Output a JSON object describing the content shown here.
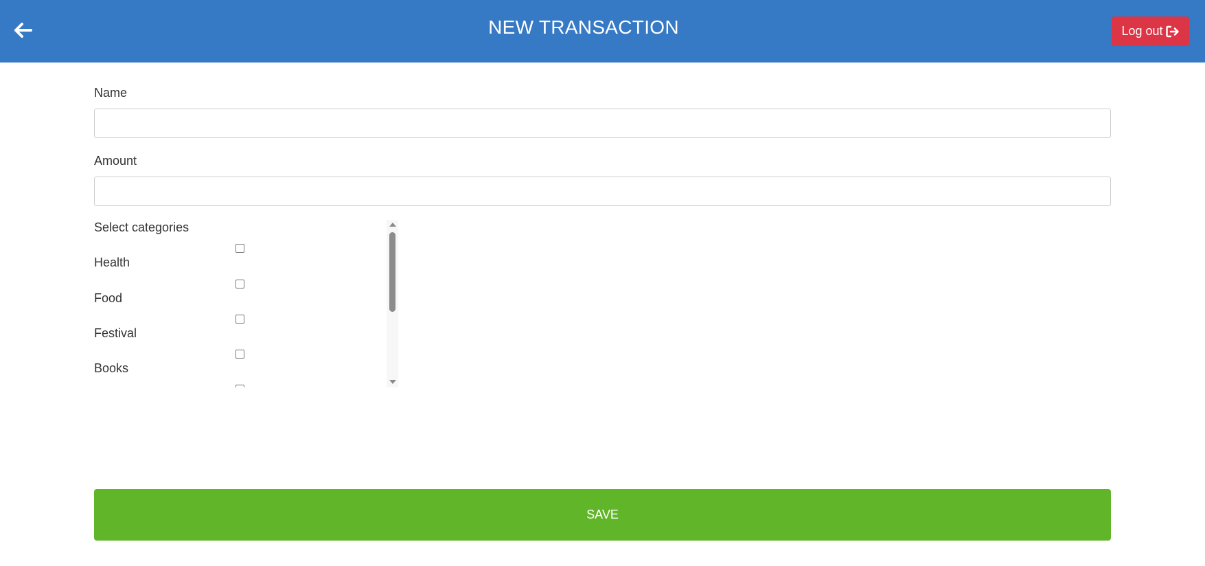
{
  "header": {
    "title": "NEW TRANSACTION",
    "back_icon": "arrow-left-icon",
    "logout_label": "Log out",
    "logout_icon": "sign-out-icon",
    "background_color": "#3679c4",
    "logout_color": "#dc3545"
  },
  "form": {
    "name_label": "Name",
    "name_value": "",
    "amount_label": "Amount",
    "amount_value": "",
    "categories_label": "Select categories",
    "categories": [
      {
        "label": "Health",
        "checked": false
      },
      {
        "label": "Food",
        "checked": false
      },
      {
        "label": "Festival",
        "checked": false
      },
      {
        "label": "Books",
        "checked": false
      }
    ]
  },
  "save": {
    "label": "SAVE",
    "color": "#61b528"
  }
}
